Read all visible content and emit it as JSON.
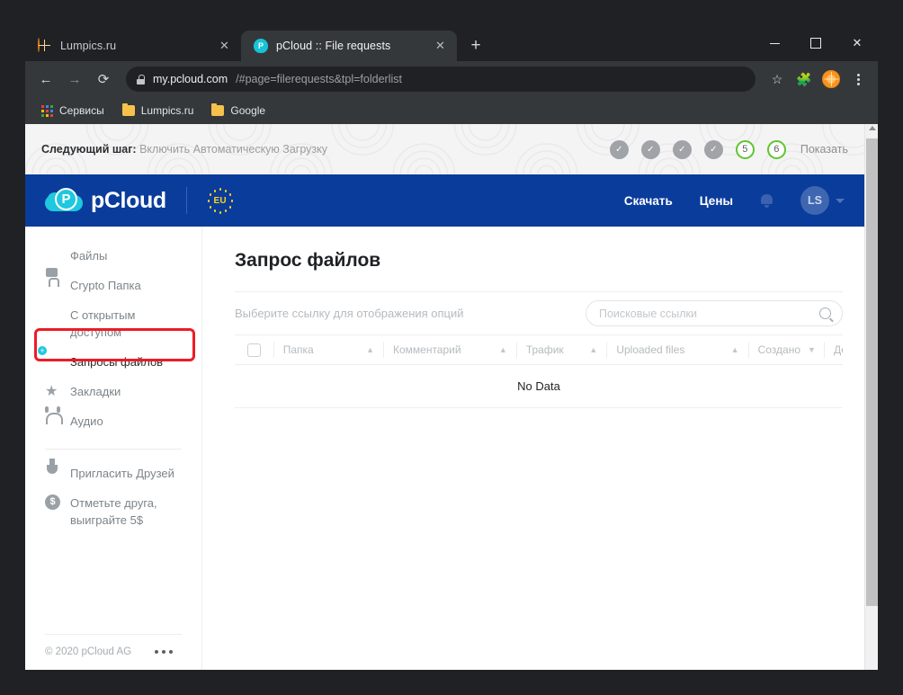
{
  "browser": {
    "tabs": [
      {
        "title": "Lumpics.ru",
        "favicon": "orange-slice-icon",
        "active": false,
        "close_label": "✕"
      },
      {
        "title": "pCloud :: File requests",
        "favicon": "pcloud-icon",
        "active": true,
        "close_label": "✕"
      }
    ],
    "new_tab_label": "+",
    "window_controls": {
      "minimize": "—",
      "maximize": "□",
      "close": "✕"
    },
    "nav": {
      "back": "←",
      "forward": "→",
      "reload": "⟳"
    },
    "omnibox": {
      "host": "my.pcloud.com",
      "path": "/#page=filerequests&tpl=folderlist",
      "lock_icon": "lock-icon"
    },
    "toolbar_icons": [
      "bookmark-star-icon",
      "extensions-puzzle-icon",
      "profile-avatar-icon",
      "chrome-menu-icon"
    ],
    "bookmarks": [
      {
        "label": "Сервисы",
        "icon": "apps-grid-icon"
      },
      {
        "label": "Lumpics.ru",
        "icon": "folder-icon"
      },
      {
        "label": "Google",
        "icon": "folder-icon"
      }
    ]
  },
  "promo": {
    "prefix": "Следующий шаг:",
    "text": "Включить Автоматическую Загрузку",
    "steps": [
      {
        "state": "done",
        "label": "✓"
      },
      {
        "state": "done",
        "label": "✓"
      },
      {
        "state": "done",
        "label": "✓"
      },
      {
        "state": "done",
        "label": "✓"
      },
      {
        "state": "open",
        "label": "5"
      },
      {
        "state": "open",
        "label": "6"
      }
    ],
    "show_label": "Показать",
    "accent_green": "#5fc52e"
  },
  "header": {
    "brand": "pCloud",
    "logo_letter": "P",
    "eu_badge": "EU",
    "nav": [
      {
        "label": "Скачать"
      },
      {
        "label": "Цены"
      }
    ],
    "bell_icon": "notification-bell-icon",
    "user_initials": "LS",
    "brand_blue": "#0a3c9b",
    "brand_cyan": "#1ec8de"
  },
  "sidebar": {
    "items": [
      {
        "label": "Файлы",
        "icon": "file-icon",
        "active": false
      },
      {
        "label": "Crypto Папка",
        "icon": "lock-icon",
        "active": false
      },
      {
        "label": "С открытым доступом",
        "icon": "shared-folder-icon",
        "active": false
      },
      {
        "label": "Запросы файлов",
        "icon": "file-request-icon",
        "active": true
      },
      {
        "label": "Закладки",
        "icon": "star-icon",
        "active": false
      },
      {
        "label": "Аудио",
        "icon": "headphones-icon",
        "active": false
      }
    ],
    "secondary": [
      {
        "label": "Пригласить Друзей",
        "icon": "trophy-icon"
      },
      {
        "label": "Отметьте друга, выиграйте 5$",
        "icon": "dollar-circle-icon"
      }
    ],
    "footer": {
      "copyright": "© 2020 pCloud AG",
      "more_icon": "more-dots-icon"
    },
    "highlight_color": "#ee1b24"
  },
  "main": {
    "title": "Запрос файлов",
    "hint": "Выберите ссылку для отображения опций",
    "search": {
      "value": "",
      "placeholder": "Поисковые ссылки",
      "icon": "search-icon"
    },
    "table": {
      "select_all_checkbox": "unchecked",
      "columns": [
        {
          "label": "Папка",
          "sort": "▲"
        },
        {
          "label": "Комментарий",
          "sort": "▲"
        },
        {
          "label": "Трафик",
          "sort": "▲"
        },
        {
          "label": "Uploaded files",
          "sort": "▲"
        },
        {
          "label": "Создано",
          "sort": "▼"
        },
        {
          "label": "Действия",
          "sort": ""
        }
      ],
      "empty_message": "No Data",
      "rows": []
    }
  }
}
